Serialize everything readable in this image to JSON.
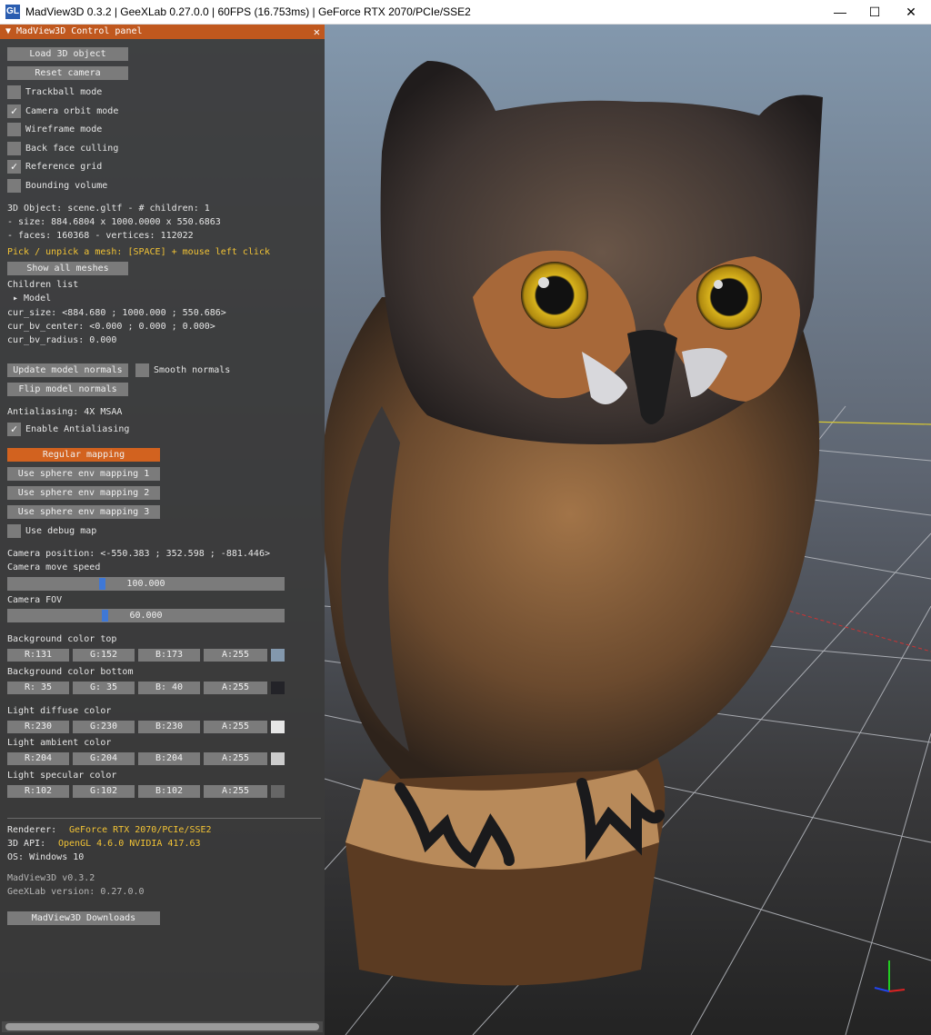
{
  "window": {
    "title": "MadView3D 0.3.2 | GeeXLab 0.27.0.0 | 60FPS (16.753ms) | GeForce RTX 2070/PCIe/SSE2",
    "icon_label": "GL",
    "minimize": "—",
    "maximize": "☐",
    "close": "✕"
  },
  "panel": {
    "title": "▼ MadView3D Control panel",
    "close": "✕",
    "load_button": "Load 3D object",
    "reset_button": "Reset camera",
    "checkboxes": [
      {
        "label": "Trackball mode",
        "checked": false
      },
      {
        "label": "Camera orbit mode",
        "checked": true
      },
      {
        "label": "Wireframe mode",
        "checked": false
      },
      {
        "label": "Back face culling",
        "checked": false
      },
      {
        "label": "Reference grid",
        "checked": true
      },
      {
        "label": "Bounding volume",
        "checked": false
      }
    ],
    "info": {
      "object": "3D Object: scene.gltf - # children: 1",
      "size": "- size:  884.6804 x 1000.0000 x 550.6863",
      "faces": "- faces: 160368 - vertices: 112022",
      "pick_hint": "Pick / unpick a mesh: [SPACE] + mouse left click"
    },
    "show_all_meshes": "Show all meshes",
    "children_list": "Children list",
    "model_node": "▸ Model",
    "cur_size": "cur_size: <884.680 ; 1000.000 ; 550.686>",
    "cur_bv_center": "cur_bv_center: <0.000 ; 0.000 ; 0.000>",
    "cur_bv_radius": "cur_bv_radius: 0.000",
    "update_normals": "Update model normals",
    "smooth_normals": "Smooth normals",
    "flip_normals": "Flip model normals",
    "antialiasing": "Antialiasing: 4X MSAA",
    "enable_aa": "Enable Antialiasing",
    "mapping_buttons": [
      "Regular mapping",
      "Use sphere env mapping 1",
      "Use sphere env mapping 2",
      "Use sphere env mapping 3"
    ],
    "debug_map": "Use debug map",
    "camera_position": "Camera position: <-550.383 ; 352.598 ; -881.446>",
    "camera_move_speed": {
      "label": "Camera move speed",
      "value": "100.000",
      "fraction": 0.34
    },
    "camera_fov": {
      "label": "Camera FOV",
      "value": "60.000",
      "fraction": 0.35
    },
    "colors": [
      {
        "label": "Background color top",
        "r": "R:131",
        "g": "G:152",
        "b": "B:173",
        "a": "A:255",
        "hex": "#8398ad"
      },
      {
        "label": "Background color bottom",
        "r": "R: 35",
        "g": "G: 35",
        "b": "B: 40",
        "a": "A:255",
        "hex": "#232328"
      },
      {
        "label": "Light diffuse color",
        "r": "R:230",
        "g": "G:230",
        "b": "B:230",
        "a": "A:255",
        "hex": "#e6e6e6"
      },
      {
        "label": "Light ambient color",
        "r": "R:204",
        "g": "G:204",
        "b": "B:204",
        "a": "A:255",
        "hex": "#cccccc"
      },
      {
        "label": "Light specular color",
        "r": "R:102",
        "g": "G:102",
        "b": "B:102",
        "a": "A:255",
        "hex": "#666666"
      }
    ],
    "renderer_label": "Renderer:",
    "renderer_value": "GeForce RTX 2070/PCIe/SSE2",
    "api_label": "3D API:",
    "api_value": "OpenGL 4.6.0 NVIDIA 417.63",
    "os": "OS: Windows 10",
    "version": "MadView3D v0.3.2",
    "geexlab": "GeeXLab version: 0.27.0.0",
    "downloads_button": "MadView3D Downloads"
  },
  "accent_color": "#d2621f",
  "highlight_text_color": "#f2c335"
}
